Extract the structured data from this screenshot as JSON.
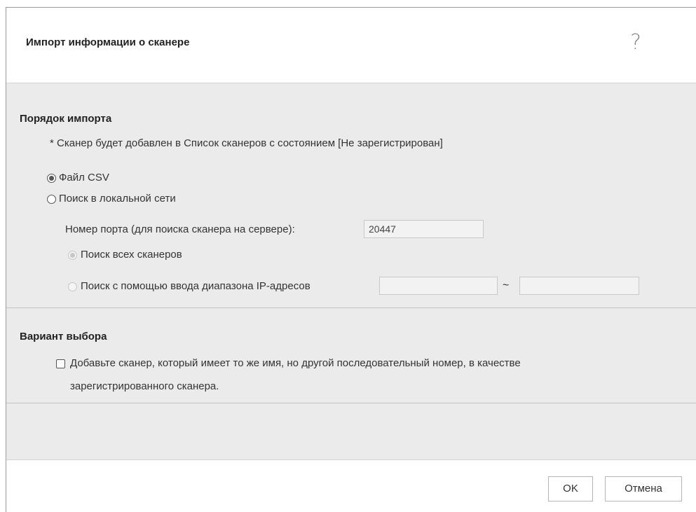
{
  "dialog": {
    "title": "Импорт информации о сканере",
    "help_glyph": "?"
  },
  "import_order": {
    "title": "Порядок импорта",
    "note": "* Сканер будет добавлен в Список сканеров с состоянием [Не зарегистрирован]",
    "options": [
      {
        "label": "Файл CSV",
        "selected": true
      },
      {
        "label": "Поиск в локальной сети",
        "selected": false
      }
    ],
    "port": {
      "label": "Номер порта (для поиска сканера на сервере):",
      "value": "20447"
    },
    "search_options": [
      {
        "label": "Поиск всех сканеров",
        "selected": true,
        "disabled": true
      },
      {
        "label": "Поиск с помощью ввода диапазона IP-адресов",
        "selected": false,
        "disabled": true
      }
    ],
    "ip_range": {
      "from": "",
      "separator": "~",
      "to": ""
    }
  },
  "selection_option": {
    "title": "Вариант выбора",
    "checkbox": {
      "checked": false,
      "label_line1": "Добавьте сканер, который имеет то же имя, но другой последовательный номер, в качестве",
      "label_line2": "зарегистрированного сканера."
    }
  },
  "footer": {
    "ok_label": "OK",
    "cancel_label": "Отмена"
  }
}
